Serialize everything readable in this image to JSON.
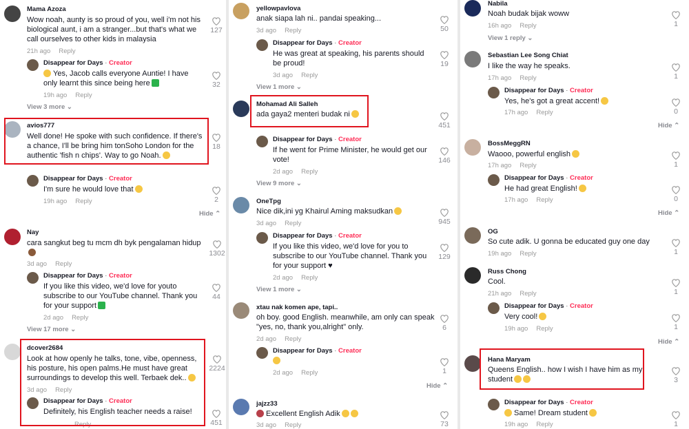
{
  "creator_label": "Creator",
  "reply_label": "Reply",
  "hide_label": "Hide",
  "col1": {
    "c1": {
      "user": "Mama Azoza",
      "text": "Wow noah, aunty is so proud of you, well i'm not his biological aunt, i am a stranger...but that's what we call ourselves to other kids in malaysia",
      "time": "21h ago",
      "likes": "127"
    },
    "r1": {
      "user": "Disappear for Days",
      "text": "Yes, Jacob calls everyone Auntie! I have only learnt this since being here",
      "time": "19h ago",
      "likes": "32"
    },
    "more1": "View 3 more",
    "c2": {
      "user": "avios777",
      "text": "Well done! He spoke with such confidence. If there's a chance, I'll be bring him tonSoho London for the authentic 'fish n chips'. Way to go Noah.",
      "likes": "18"
    },
    "r2": {
      "user": "Disappear for Days",
      "text": "I'm sure he would love that",
      "time": "19h ago",
      "likes": "2"
    },
    "c3": {
      "user": "Nay",
      "text": "cara sangkut beg tu mcm dh byk pengalaman hidup",
      "time": "3d ago",
      "likes": "1302"
    },
    "r3": {
      "user": "Disappear for Days",
      "text": "If you like this video, we'd love for youto subscribe to our YouTube channel. Thank you for your support",
      "time": "2d ago",
      "likes": "44"
    },
    "more3": "View 17 more",
    "c4": {
      "user": "dcover2684",
      "text": "Look at how openly he talks, tone, vibe, openness, his posture, his open palms.He must have great surroundings to develop this well. Terbaek dek..",
      "time": "3d ago",
      "likes": "2224"
    },
    "r4": {
      "user": "Disappear for Days",
      "text": "Definitely, his English teacher needs a raise!",
      "likes": "451"
    }
  },
  "col2": {
    "c1": {
      "user": "yellowpavlova",
      "text": "anak siapa lah ni.. pandai speaking...",
      "time": "3d ago",
      "likes": "50"
    },
    "r1": {
      "user": "Disappear for Days",
      "text": "He was great at speaking, his parents should be proud!",
      "time": "3d ago",
      "likes": "19"
    },
    "more1": "View 1 more",
    "c2": {
      "user": "Mohamad Ali Salleh",
      "text": "ada gaya2 menteri budak ni",
      "likes": "451"
    },
    "r2": {
      "user": "Disappear for Days",
      "text": "If he went for Prime Minister, he would get our vote!",
      "time": "2d ago",
      "likes": "146"
    },
    "more2": "View 9 more",
    "c3": {
      "user": "OneTpg",
      "text": "Nice dik,ini yg Khairul Aming maksudkan",
      "time": "3d ago",
      "likes": "945"
    },
    "r3": {
      "user": "Disappear for Days",
      "text": "If you like this video, we'd love for you to subscribe to our YouTube channel. Thank you for your support ♥",
      "time": "2d ago",
      "likes": "129"
    },
    "more3": "View 1 more",
    "c4": {
      "user": "xtau nak komen ape, tapi..",
      "text": "oh boy. good English. meanwhile, am only can speak \"yes, no, thank you,alright\" only.",
      "time": "2d ago",
      "likes": "6"
    },
    "r4": {
      "user": "Disappear for Days",
      "text": "",
      "time": "2d ago",
      "likes": "1"
    },
    "c5": {
      "user": "jajzz33",
      "text": "Excellent English Adik",
      "time": "3d ago",
      "likes": "73"
    }
  },
  "col3": {
    "c1": {
      "user": "Nabila",
      "text": "Noah budak bijak woww",
      "time": "16h ago",
      "likes": "1"
    },
    "more1": "View 1 reply",
    "c2": {
      "user": "Sebastian Lee Song Chiat",
      "text": "I like the way he speaks.",
      "time": "17h ago",
      "likes": "1"
    },
    "r2": {
      "user": "Disappear for Days",
      "text": "Yes, he's got a great accent!",
      "time": "17h ago",
      "likes": "0"
    },
    "c3": {
      "user": "BossMeggRN",
      "text": "Waooo, powerful english",
      "time": "17h ago",
      "likes": "1"
    },
    "r3": {
      "user": "Disappear for Days",
      "text": "He had great English!",
      "time": "17h ago",
      "likes": "0"
    },
    "c4": {
      "user": "OG",
      "text": "So cute adik. U gonna be educated guy one day",
      "time": "19h ago",
      "likes": "1"
    },
    "c5": {
      "user": "Russ Chong",
      "text": "Cool.",
      "time": "21h ago",
      "likes": "1"
    },
    "r5": {
      "user": "Disappear for Days",
      "text": "Very cool!",
      "time": "19h ago",
      "likes": "1"
    },
    "c6": {
      "user": "Hana Maryam",
      "text": "Queens English.. how I wish I have him as my student",
      "likes": "3"
    },
    "r6": {
      "user": "Disappear for Days",
      "text": "Same! Dream student",
      "time": "19h ago",
      "likes": "1"
    }
  }
}
